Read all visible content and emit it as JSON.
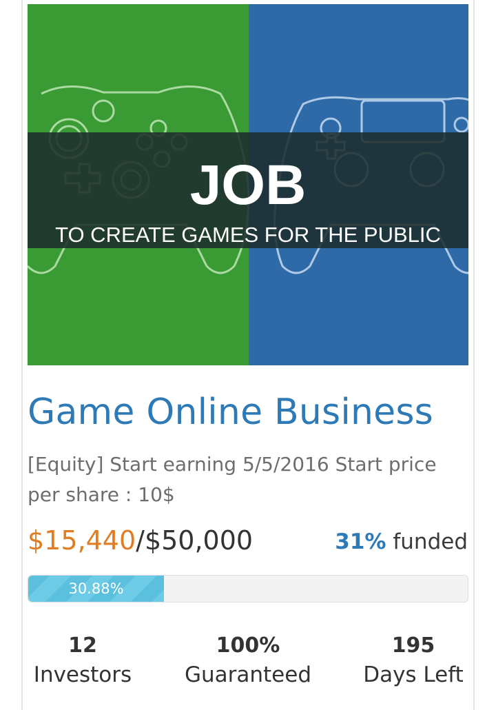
{
  "banner": {
    "headline": "JOB",
    "subline": "TO CREATE GAMES FOR THE PUBLIC",
    "left_color": "#3a9b35",
    "right_color": "#2e69a8",
    "band_color": "#1e2e2e"
  },
  "project": {
    "title": "Game Online Business",
    "description": "[Equity] Start earning 5/5/2016 Start price per share : 10$"
  },
  "funding": {
    "raised": "$15,440",
    "goal": "/$50,000",
    "percent_funded": "31%",
    "funded_label": " funded",
    "progress_label": "30.88%",
    "progress_value": 30.88
  },
  "stats": [
    {
      "value": "12",
      "label": "Investors"
    },
    {
      "value": "100%",
      "label": "Guaranteed"
    },
    {
      "value": "195",
      "label": "Days Left"
    }
  ],
  "colors": {
    "accent": "#2e7ab6",
    "raised": "#e07d22",
    "progress": "#5bc0de"
  }
}
